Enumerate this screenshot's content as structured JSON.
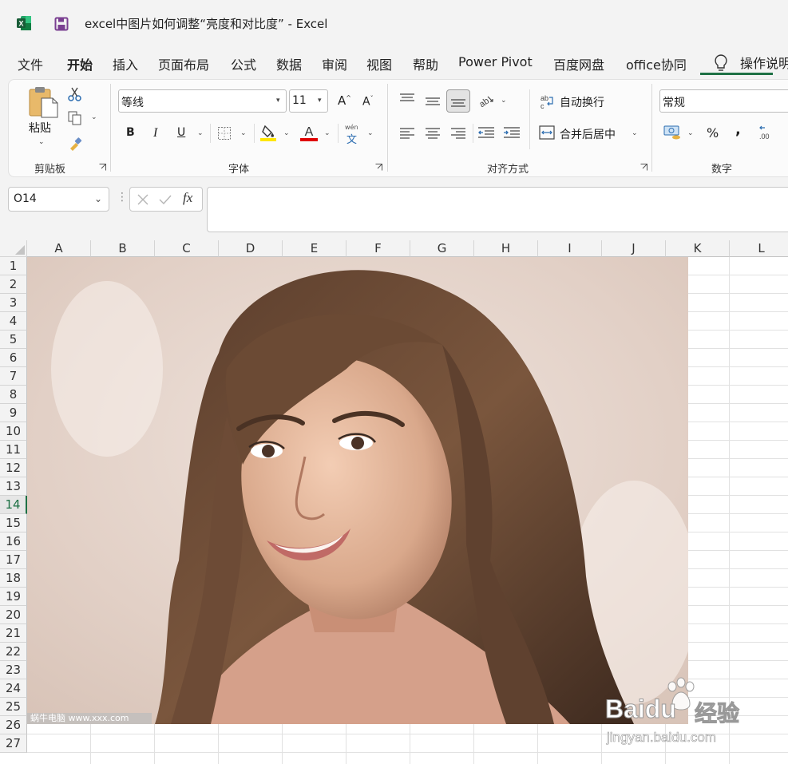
{
  "window": {
    "title": "excel中图片如何调整“亮度和对比度”  -  Excel",
    "accent_color": "#1e7145"
  },
  "menu": {
    "tabs": [
      "文件",
      "开始",
      "插入",
      "页面布局",
      "公式",
      "数据",
      "审阅",
      "视图",
      "帮助",
      "Power Pivot",
      "百度网盘",
      "office协同",
      "操作说明"
    ],
    "active_tab": "开始"
  },
  "ribbon": {
    "clipboard": {
      "paste_label": "粘贴",
      "group_label": "剪贴板"
    },
    "font": {
      "font_name": "等线",
      "font_size": "11",
      "group_label": "字体",
      "bold": "B",
      "italic": "I",
      "underline": "U",
      "phonetic": "wén"
    },
    "alignment": {
      "wrap_text": "自动换行",
      "merge_center": "合并后居中",
      "group_label": "对齐方式"
    },
    "number": {
      "format": "常规",
      "percent": "%",
      "comma": ",",
      "group_label": "数字"
    }
  },
  "formula_bar": {
    "name_box": "O14",
    "fx": "fx",
    "value": ""
  },
  "grid": {
    "columns": [
      "A",
      "B",
      "C",
      "D",
      "E",
      "F",
      "G",
      "H",
      "I",
      "J",
      "K",
      "L"
    ],
    "rows": [
      "1",
      "2",
      "3",
      "4",
      "5",
      "6",
      "7",
      "8",
      "9",
      "10",
      "11",
      "12",
      "13",
      "14",
      "15",
      "16",
      "17",
      "18",
      "19",
      "20",
      "21",
      "22",
      "23",
      "24",
      "25",
      "26",
      "27"
    ],
    "selected_row": "14"
  },
  "picture": {
    "overlay_text": "蜗牛电脑 www.xxx.com"
  },
  "watermark": {
    "brand": "Baidu",
    "suffix": "经验",
    "url": "jingyan.baidu.com"
  }
}
